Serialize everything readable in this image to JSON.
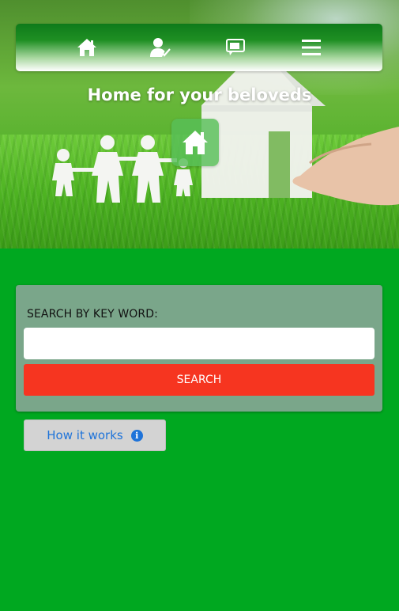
{
  "nav": {
    "items": [
      {
        "name": "home",
        "icon": "home-icon"
      },
      {
        "name": "profile",
        "icon": "user-check-icon"
      },
      {
        "name": "messages",
        "icon": "chat-bubbles-icon"
      },
      {
        "name": "menu",
        "icon": "hamburger-menu-icon"
      }
    ]
  },
  "hero": {
    "title": "Home for your beloveds",
    "badge_icon": "home-icon"
  },
  "search": {
    "label": "SEARCH BY KEY WORD:",
    "input_value": "",
    "placeholder": "",
    "button_label": "SEARCH"
  },
  "how_it_works": {
    "label": "How it works",
    "icon": "info-icon",
    "icon_glyph": "i"
  },
  "colors": {
    "page_background": "#00a820",
    "nav_gradient_top": "#0e7a1a",
    "search_panel": "#7aa68a",
    "search_button": "#f63520",
    "how_button_bg": "#d3d3d3",
    "link_blue": "#1e73d9"
  }
}
